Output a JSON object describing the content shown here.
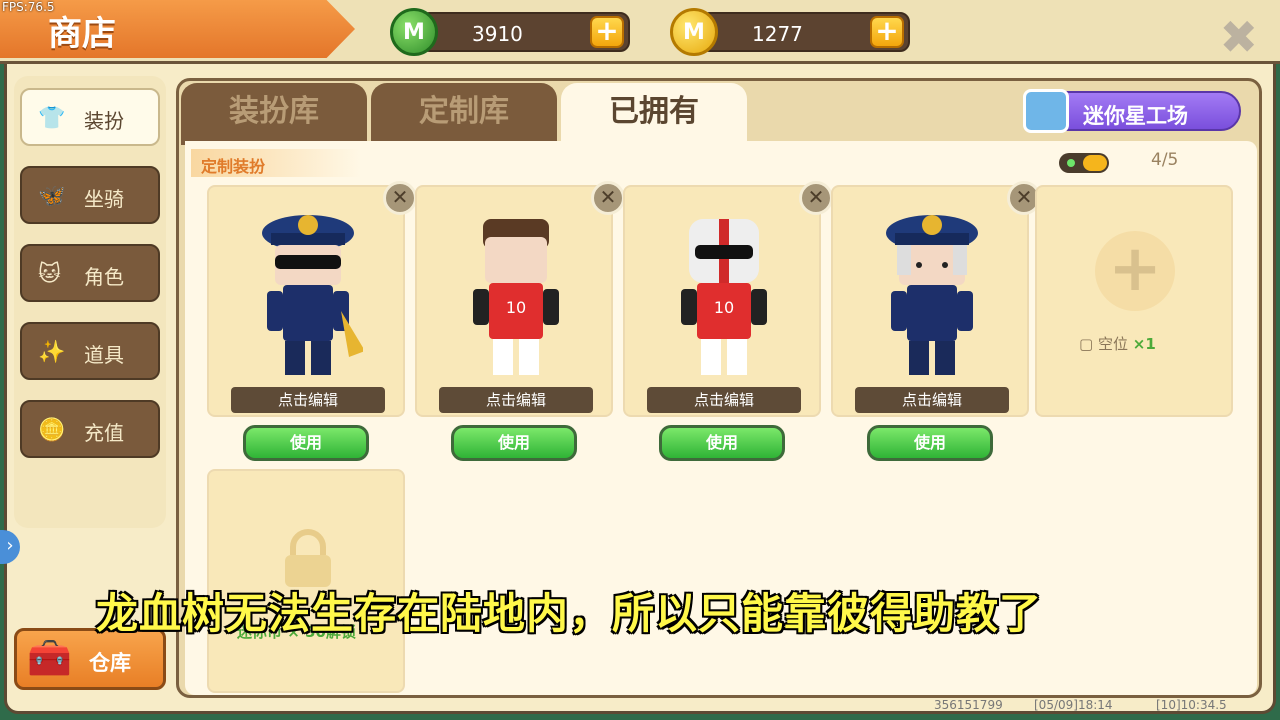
{
  "fps": "FPS:76.5",
  "header": {
    "title": "商店",
    "gems": "3910",
    "coins": "1277",
    "plus": "+",
    "close": "✖"
  },
  "sidebar": {
    "items": [
      {
        "label": "装扮",
        "icon": "shirt-icon",
        "glyph": "👕"
      },
      {
        "label": "坐骑",
        "icon": "mount-icon",
        "glyph": "🦋"
      },
      {
        "label": "角色",
        "icon": "character-icon",
        "glyph": "🐱"
      },
      {
        "label": "道具",
        "icon": "item-icon",
        "glyph": "✨"
      },
      {
        "label": "充值",
        "icon": "coins-icon",
        "glyph": "🪙"
      }
    ],
    "warehouse": {
      "label": "仓库",
      "glyph": "🧰"
    }
  },
  "tabs": [
    {
      "label": "装扮库"
    },
    {
      "label": "定制库"
    },
    {
      "label": "已拥有"
    }
  ],
  "workshop": {
    "label": "迷你星工场"
  },
  "section": {
    "label": "定制装扮",
    "count": "4/5"
  },
  "cards": [
    {
      "edit": "点击编辑",
      "use": "使用",
      "outfit": "police"
    },
    {
      "edit": "点击编辑",
      "use": "使用",
      "outfit": "football"
    },
    {
      "edit": "点击编辑",
      "use": "使用",
      "outfit": "football-helmet"
    },
    {
      "edit": "点击编辑",
      "use": "使用",
      "outfit": "police-2"
    }
  ],
  "empty_slot": {
    "label": "空位",
    "count": "×1",
    "plus": "+"
  },
  "locked_slot": {
    "label": "迷你币 × 50解锁"
  },
  "subtitle": "龙血树无法生存在陆地内，所以只能靠彼得助教了",
  "footer": {
    "left": "356151799",
    "mid": "[05/09]18:14",
    "right": "[10]10:34.5"
  }
}
